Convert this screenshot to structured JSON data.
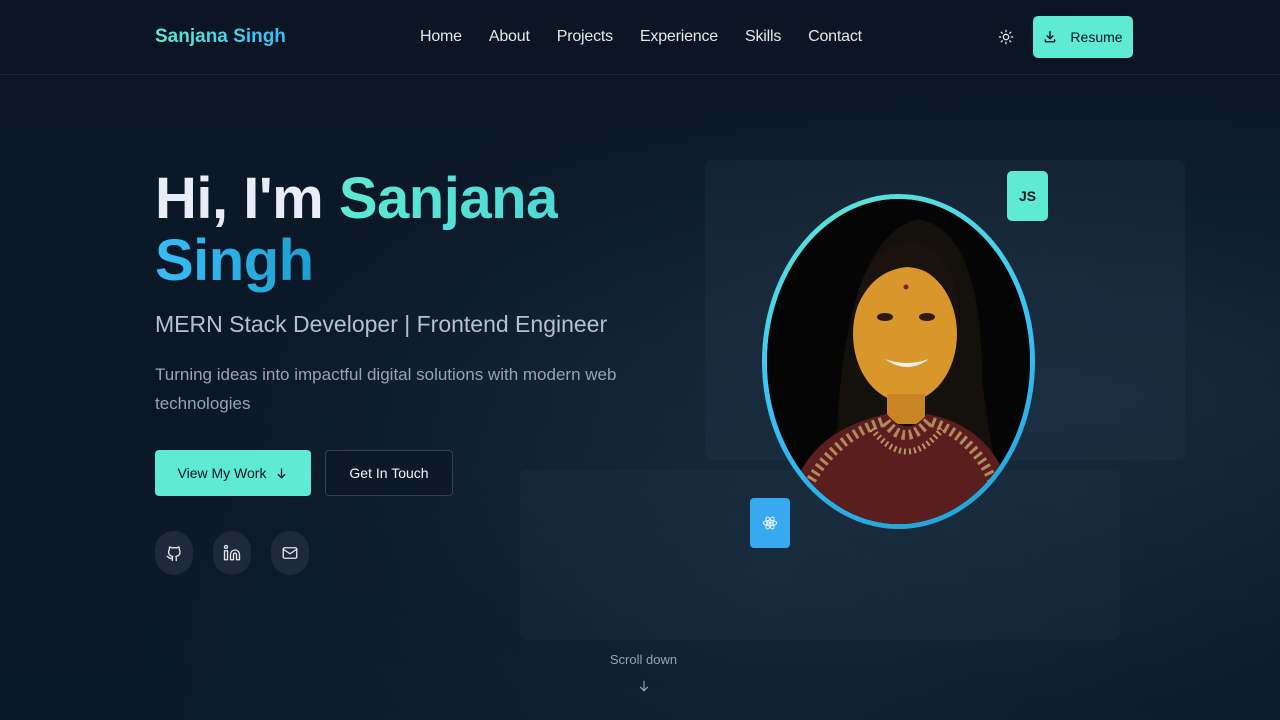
{
  "header": {
    "logo": "Sanjana Singh",
    "nav": [
      "Home",
      "About",
      "Projects",
      "Experience",
      "Skills",
      "Contact"
    ],
    "resume_label": "Resume",
    "theme_icon": "sun-icon"
  },
  "hero": {
    "greeting": "Hi, I'm ",
    "first_name": "Sanjana",
    "last_name": "Singh",
    "subtitle": "MERN Stack Developer | Frontend Engineer",
    "tagline": "Turning ideas into impactful digital solutions with modern web technologies",
    "primary_cta": "View My Work",
    "secondary_cta": "Get In Touch",
    "socials": [
      "github-icon",
      "linkedin-icon",
      "mail-icon"
    ]
  },
  "profile": {
    "badge_js": "JS",
    "badge_react_icon": "react-icon"
  },
  "scroll": {
    "label": "Scroll down"
  },
  "colors": {
    "accent": "#5eead4",
    "accent_blue": "#38bdf8",
    "background": "#0b1624"
  }
}
